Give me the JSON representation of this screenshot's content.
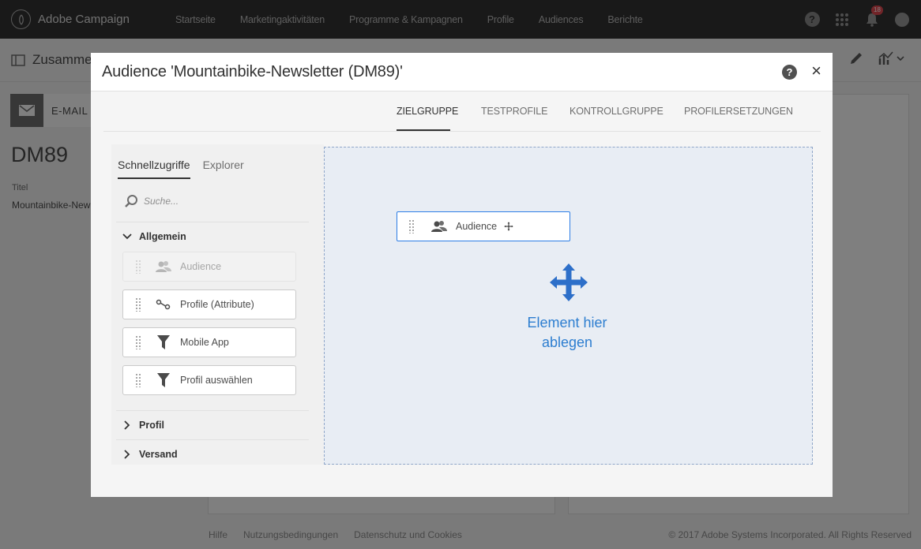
{
  "app": {
    "name": "Adobe Campaign",
    "nav": [
      "Startseite",
      "Marketingaktivitäten",
      "Programme & Kampagnen",
      "Profile",
      "Audiences",
      "Berichte"
    ],
    "notification_count": "18"
  },
  "background": {
    "page_title": "Zusamme",
    "card_label": "E-MAIL",
    "delivery_id": "DM89",
    "title_label": "Titel",
    "title_value": "Mountainbike-New",
    "footer": {
      "help": "Hilfe",
      "terms": "Nutzungsbedingungen",
      "privacy": "Datenschutz und Cookies",
      "copyright": "© 2017 Adobe Systems Incorporated. All Rights Reserved"
    }
  },
  "modal": {
    "title": "Audience 'Mountainbike-Newsletter (DM89)'",
    "help_label": "?",
    "close_label": "×",
    "tabs": [
      "ZIELGRUPPE",
      "TESTPROFILE",
      "KONTROLLGRUPPE",
      "PROFILERSETZUNGEN"
    ],
    "active_tab": "ZIELGRUPPE",
    "palette": {
      "tabs": [
        "Schnellzugriffe",
        "Explorer"
      ],
      "search_placeholder": "Suche...",
      "sections": {
        "general": "Allgemein",
        "profile": "Profil",
        "delivery": "Versand"
      },
      "items": [
        {
          "label": "Audience",
          "icon": "audience-icon",
          "disabled": true
        },
        {
          "label": "Profile (Attribute)",
          "icon": "attribute-link-icon",
          "disabled": false
        },
        {
          "label": "Mobile App",
          "icon": "filter-icon",
          "disabled": false
        },
        {
          "label": "Profil auswählen",
          "icon": "filter-icon",
          "disabled": false
        }
      ]
    },
    "dragged_item": {
      "label": "Audience",
      "icon": "audience-icon"
    },
    "drop_zone": {
      "line1": "Element hier",
      "line2": "ablegen"
    }
  },
  "colors": {
    "topbar": "#323232",
    "accent": "#2d7ee6",
    "drop_text": "#2d7ed0",
    "badge": "#e34850"
  }
}
